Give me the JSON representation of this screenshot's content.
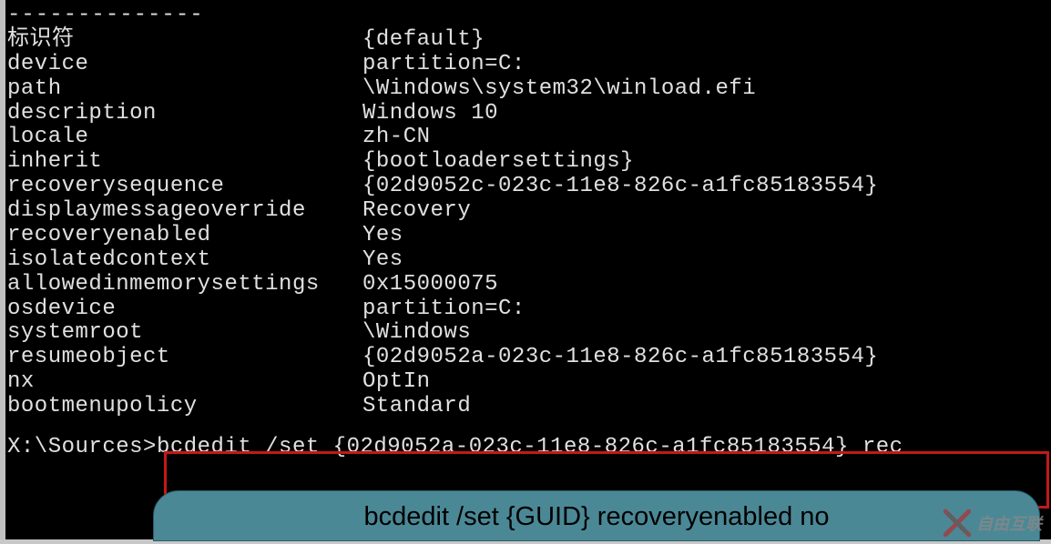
{
  "dashes": "--------------",
  "entries": [
    {
      "key": "标识符",
      "val": "{default}"
    },
    {
      "key": "device",
      "val": "partition=C:"
    },
    {
      "key": "path",
      "val": "\\Windows\\system32\\winload.efi"
    },
    {
      "key": "description",
      "val": "Windows 10"
    },
    {
      "key": "locale",
      "val": "zh-CN"
    },
    {
      "key": "inherit",
      "val": "{bootloadersettings}"
    },
    {
      "key": "recoverysequence",
      "val": "{02d9052c-023c-11e8-826c-a1fc85183554}"
    },
    {
      "key": "displaymessageoverride",
      "val": "Recovery"
    },
    {
      "key": "recoveryenabled",
      "val": "Yes"
    },
    {
      "key": "isolatedcontext",
      "val": "Yes"
    },
    {
      "key": "allowedinmemorysettings",
      "val": "0x15000075"
    },
    {
      "key": "osdevice",
      "val": "partition=C:"
    },
    {
      "key": "systemroot",
      "val": "\\Windows"
    },
    {
      "key": "resumeobject",
      "val": "{02d9052a-023c-11e8-826c-a1fc85183554}"
    },
    {
      "key": "nx",
      "val": "OptIn"
    },
    {
      "key": "bootmenupolicy",
      "val": "Standard"
    }
  ],
  "prompt": {
    "path": "X:\\Sources>",
    "command": "bcdedit /set {02d9052a-023c-11e8-826c-a1fc85183554} rec"
  },
  "bubble_text": "bcdedit /set {GUID} recoveryenabled no",
  "watermark_text": "自由互联"
}
